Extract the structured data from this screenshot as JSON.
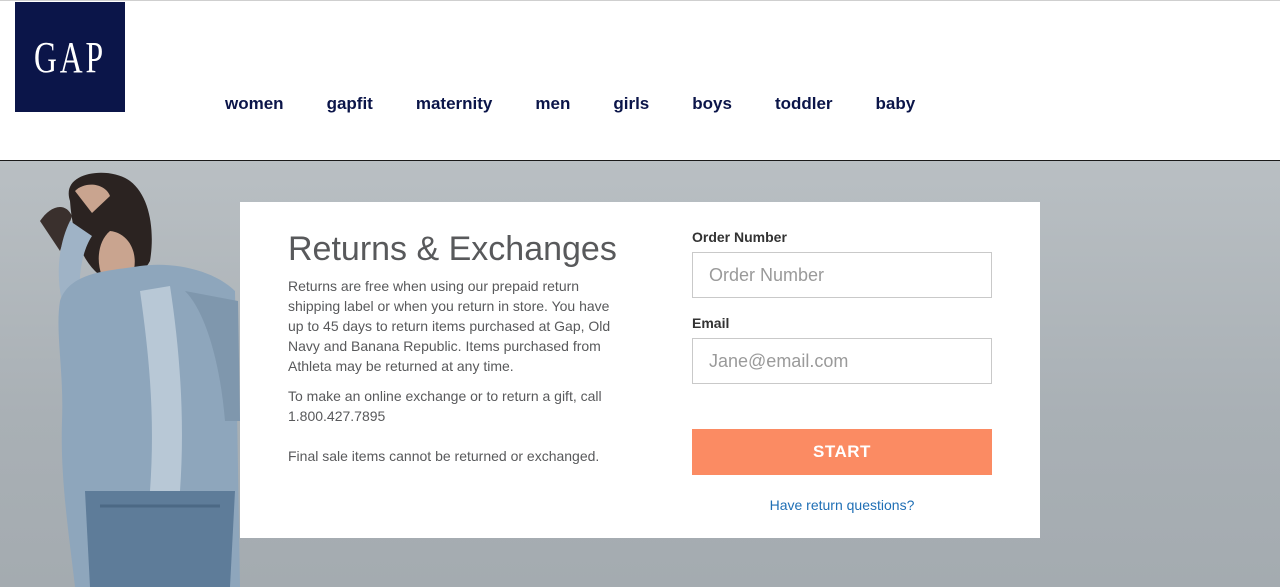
{
  "header": {
    "logo_text": "GAP",
    "nav": [
      "women",
      "gapfit",
      "maternity",
      "men",
      "girls",
      "boys",
      "toddler",
      "baby"
    ]
  },
  "returns": {
    "title": "Returns & Exchanges",
    "paragraph1": "Returns are free when using our prepaid return shipping label or when you return in store. You have up to 45 days to return items purchased at Gap, Old Navy and Banana Republic. Items purchased from Athleta may be returned at any time.",
    "paragraph2": "To make an online exchange or to return a gift, call 1.800.427.7895",
    "paragraph3": "Final sale items cannot be returned or exchanged."
  },
  "form": {
    "order_label": "Order Number",
    "order_placeholder": "Order Number",
    "order_value": "",
    "email_label": "Email",
    "email_placeholder": "Jane@email.com",
    "email_value": "",
    "start_label": "START",
    "help_link": "Have return questions?"
  },
  "colors": {
    "brand_navy": "#0b1549",
    "start_button": "#fb8b63",
    "link_blue": "#1f6fb5"
  }
}
